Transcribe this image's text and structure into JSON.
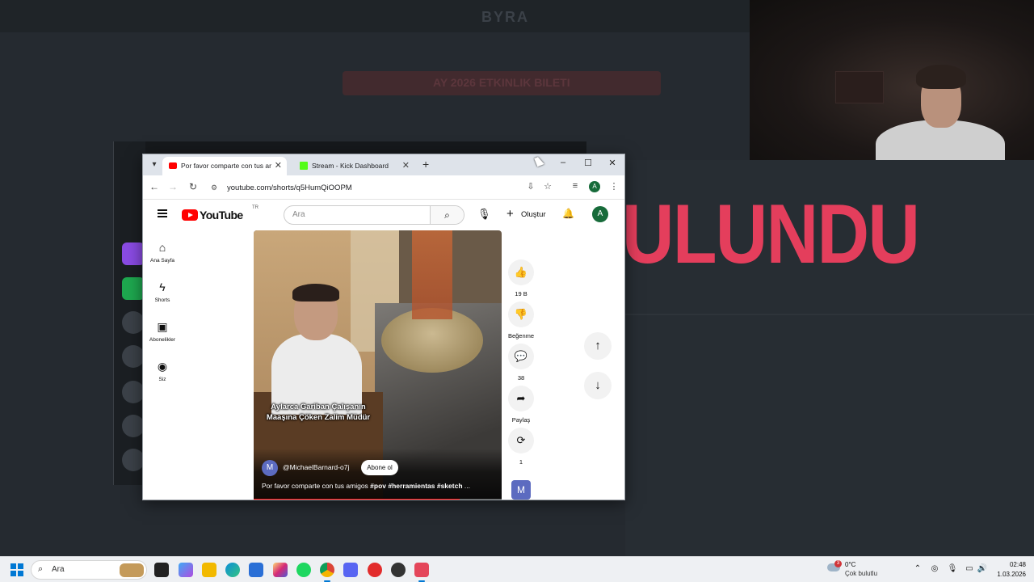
{
  "background": {
    "big_word": "ULUNDU",
    "accent_color": "#e43e5c",
    "brand_text": "BYRA",
    "banner_text": "AY 2026 ETKINLIK BILETI"
  },
  "browser": {
    "tabs": [
      {
        "title": "Por favor comparte con tus amigos",
        "icon": "youtube-favicon",
        "active": true
      },
      {
        "title": "Stream - Kick Dashboard",
        "icon": "kick-favicon",
        "active": false
      }
    ],
    "new_tab_glyph": "+",
    "url": "youtube.com/shorts/q5HumQiOOPM",
    "profile_initial": "A"
  },
  "youtube": {
    "logo_text": "YouTube",
    "country_code": "TR",
    "search_placeholder": "Ara",
    "create_label": "Oluştur",
    "avatar_initial": "A",
    "sidebar": [
      {
        "label": "Ana Sayfa",
        "icon": "home-icon",
        "glyph": "⌂"
      },
      {
        "label": "Shorts",
        "icon": "shorts-icon",
        "glyph": "ϟ"
      },
      {
        "label": "Abonelikler",
        "icon": "subscriptions-icon",
        "glyph": "▣"
      },
      {
        "label": "Siz",
        "icon": "you-icon",
        "glyph": "◉"
      }
    ],
    "video": {
      "caption": "Aylarca Gariban Çalışanın Maaşına Çöken Zalim Müdür",
      "channel_initial": "M",
      "channel": "@MichaelBarnard-o7j",
      "subscribe_label": "Abone ol",
      "description_plain": "Por favor comparte con tus amigos ",
      "description_tags": "#pov #herramientas #sketch",
      "description_ellipsis": " ...",
      "progress": 0.83
    },
    "actions": [
      {
        "icon": "like-icon",
        "glyph": "👍",
        "value": "19 B"
      },
      {
        "icon": "dislike-icon",
        "glyph": "👎",
        "value": "Beğenme"
      },
      {
        "icon": "comment-icon",
        "glyph": "💬",
        "value": "38"
      },
      {
        "icon": "share-icon",
        "glyph": "➦",
        "value": "Paylaş"
      },
      {
        "icon": "remix-icon",
        "glyph": "⟳",
        "value": "1"
      }
    ],
    "channel_thumb_initial": "M"
  },
  "taskbar": {
    "search_placeholder": "Ara",
    "weather_badge": "3",
    "temperature": "0°C",
    "condition": "Çok bulutlu",
    "time": "02:48",
    "date": "1.03.2026"
  }
}
